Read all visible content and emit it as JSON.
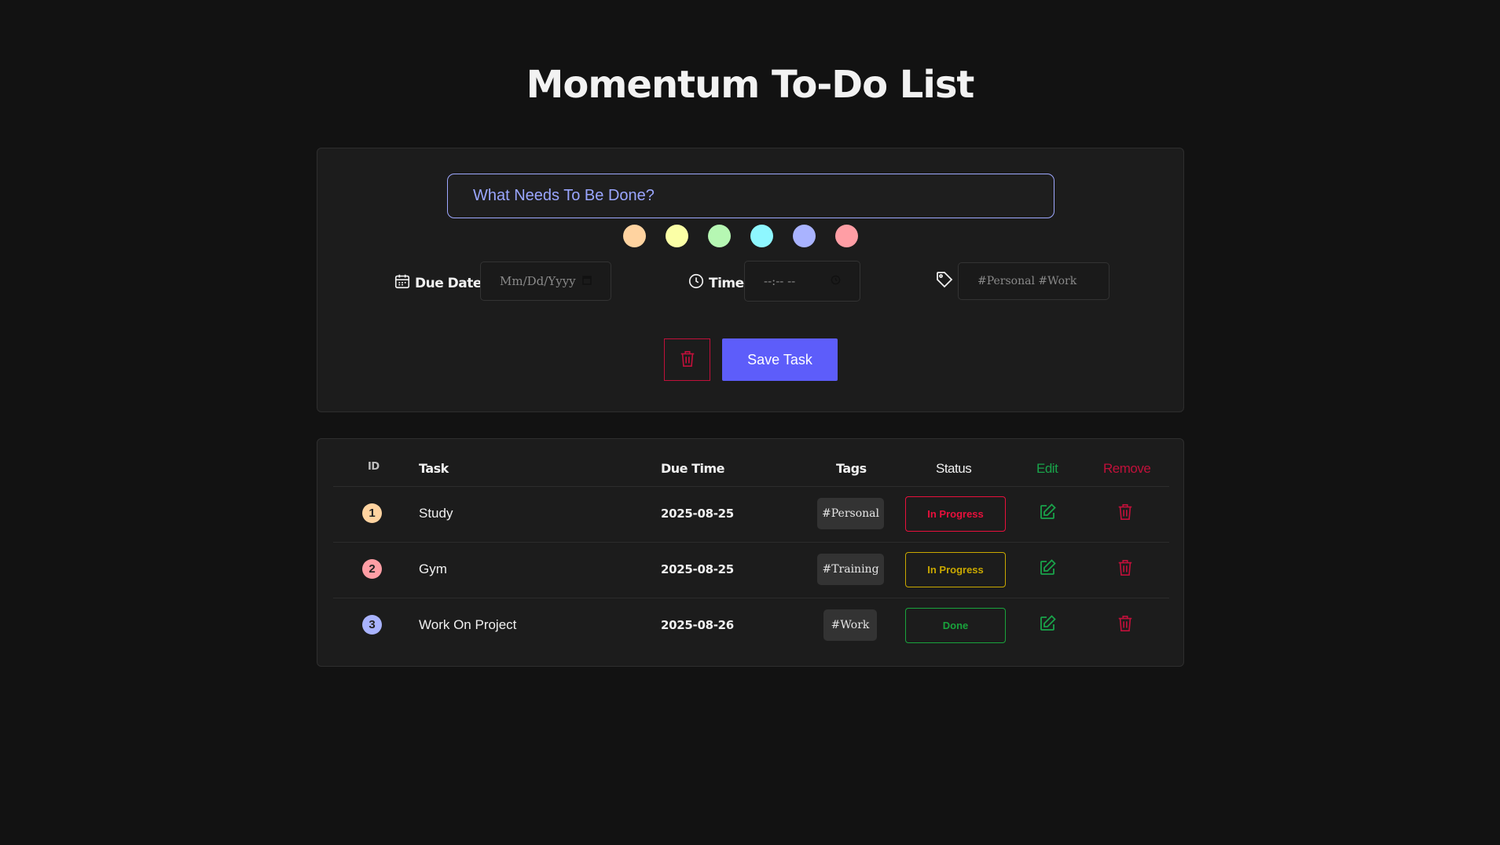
{
  "app": {
    "title": "Momentum To-Do List"
  },
  "form": {
    "task_placeholder": "What Needs To Be Done?",
    "colors": [
      "#ffd3a0",
      "#fbffa6",
      "#b6f7b3",
      "#8ef7ff",
      "#a9b3ff",
      "#ff9ea5"
    ],
    "due_date_label": "Due Date",
    "due_date_placeholder": "Mm/Dd/Yyyy",
    "time_label": "Time",
    "time_placeholder": "--:-- --",
    "tags_placeholder": "#Personal #Work",
    "save_label": "Save Task"
  },
  "table": {
    "headers": {
      "id": "ID",
      "task": "Task",
      "due_time": "Due Time",
      "tags": "Tags",
      "status": "Status",
      "edit": "Edit",
      "remove": "Remove"
    },
    "rows": [
      {
        "id": "1",
        "task": "Study",
        "due": "2025-08-25",
        "tag": "#Personal",
        "status": "In Progress",
        "color": "#ffd3a0",
        "status_color": "#e8103c"
      },
      {
        "id": "2",
        "task": "Gym",
        "due": "2025-08-25",
        "tag": "#Training",
        "status": "In Progress",
        "color": "#ff9ea5",
        "status_color": "#c9a800"
      },
      {
        "id": "3",
        "task": "Work On Project",
        "due": "2025-08-26",
        "tag": "#Work",
        "status": "Done",
        "color": "#a9b3ff",
        "status_color": "#19a33c"
      }
    ]
  },
  "colors": {
    "accent": "#5d5dfa",
    "edit": "#19a34a",
    "remove": "#c0103a"
  }
}
